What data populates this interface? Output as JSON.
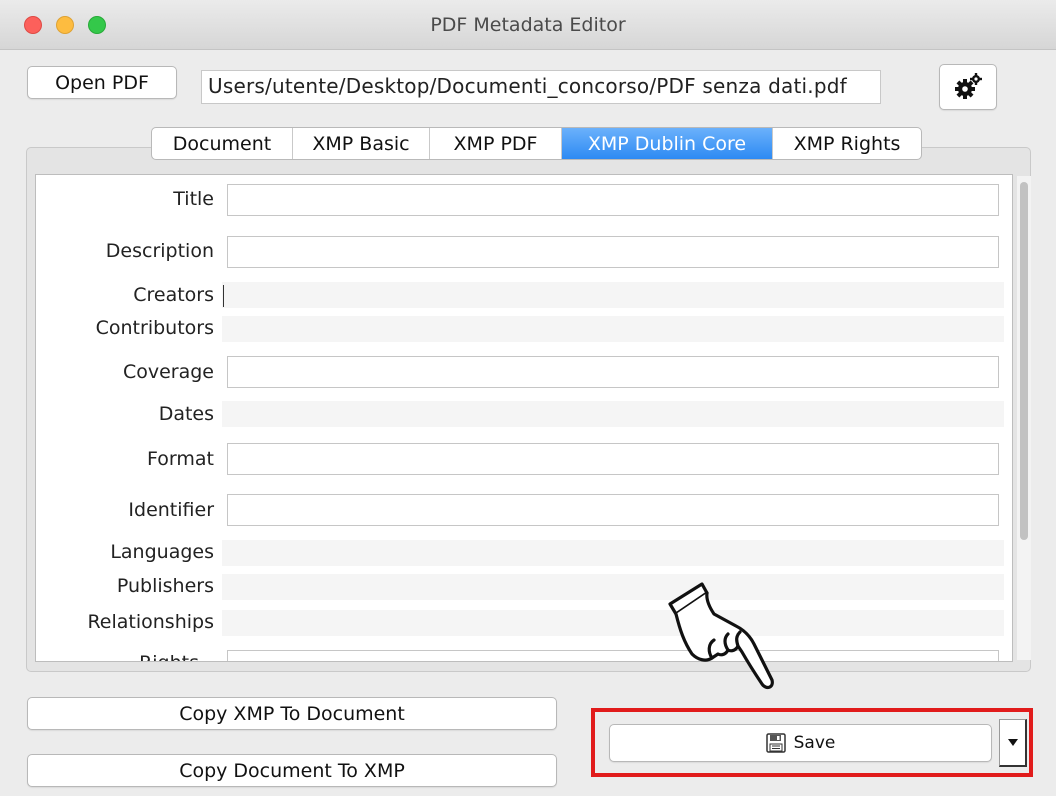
{
  "window": {
    "title": "PDF Metadata Editor"
  },
  "toolbar": {
    "open_label": "Open PDF",
    "file_path": "Users/utente/Desktop/Documenti_concorso/PDF senza dati.pdf",
    "settings_icon": "gears-icon"
  },
  "tabs": [
    {
      "label": "Document",
      "active": false
    },
    {
      "label": "XMP Basic",
      "active": false
    },
    {
      "label": "XMP PDF",
      "active": false
    },
    {
      "label": "XMP Dublin Core",
      "active": true
    },
    {
      "label": "XMP Rights",
      "active": false
    }
  ],
  "fields": {
    "title": {
      "label": "Title",
      "value": ""
    },
    "description": {
      "label": "Description",
      "value": ""
    },
    "creators": {
      "label": "Creators",
      "value": ""
    },
    "contributors": {
      "label": "Contributors",
      "value": ""
    },
    "coverage": {
      "label": "Coverage",
      "value": ""
    },
    "dates": {
      "label": "Dates",
      "value": ""
    },
    "format": {
      "label": "Format",
      "value": ""
    },
    "identifier": {
      "label": "Identifier",
      "value": ""
    },
    "languages": {
      "label": "Languages",
      "value": ""
    },
    "publishers": {
      "label": "Publishers",
      "value": ""
    },
    "relationships": {
      "label": "Relationships",
      "value": ""
    },
    "rights": {
      "label": "Rights",
      "value": ""
    }
  },
  "actions": {
    "copy_xmp_to_document": "Copy XMP To Document",
    "copy_document_to_xmp": "Copy Document To XMP",
    "save_label": "Save",
    "save_icon": "floppy-disk-icon",
    "dropdown_icon": "triangle-down-icon"
  },
  "annotations": {
    "highlight_color": "#e11b1b",
    "pointer": "pointing-hand-icon"
  },
  "colors": {
    "active_tab": "#2d8af3",
    "highlight": "#e11b1b"
  }
}
